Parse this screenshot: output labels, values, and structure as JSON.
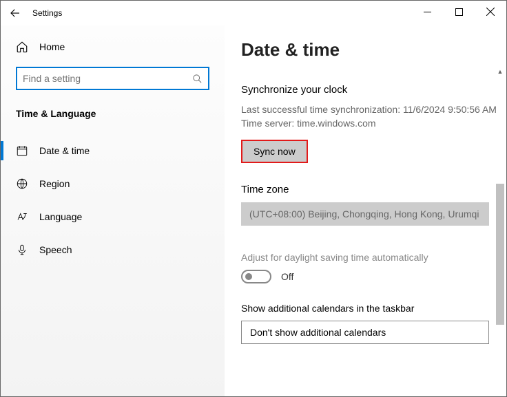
{
  "titlebar": {
    "app_name": "Settings"
  },
  "sidebar": {
    "home_label": "Home",
    "search_placeholder": "Find a setting",
    "category_label": "Time & Language",
    "items": [
      {
        "label": "Date & time"
      },
      {
        "label": "Region"
      },
      {
        "label": "Language"
      },
      {
        "label": "Speech"
      }
    ]
  },
  "main": {
    "page_title": "Date & time",
    "sync": {
      "heading": "Synchronize your clock",
      "last_sync": "Last successful time synchronization: 11/6/2024 9:50:56 AM",
      "server": "Time server: time.windows.com",
      "button_label": "Sync now"
    },
    "timezone": {
      "heading": "Time zone",
      "value": "(UTC+08:00) Beijing, Chongqing, Hong Kong, Urumqi"
    },
    "dst": {
      "heading": "Adjust for daylight saving time automatically",
      "state_label": "Off"
    },
    "calendars": {
      "heading": "Show additional calendars in the taskbar",
      "value": "Don't show additional calendars"
    }
  }
}
